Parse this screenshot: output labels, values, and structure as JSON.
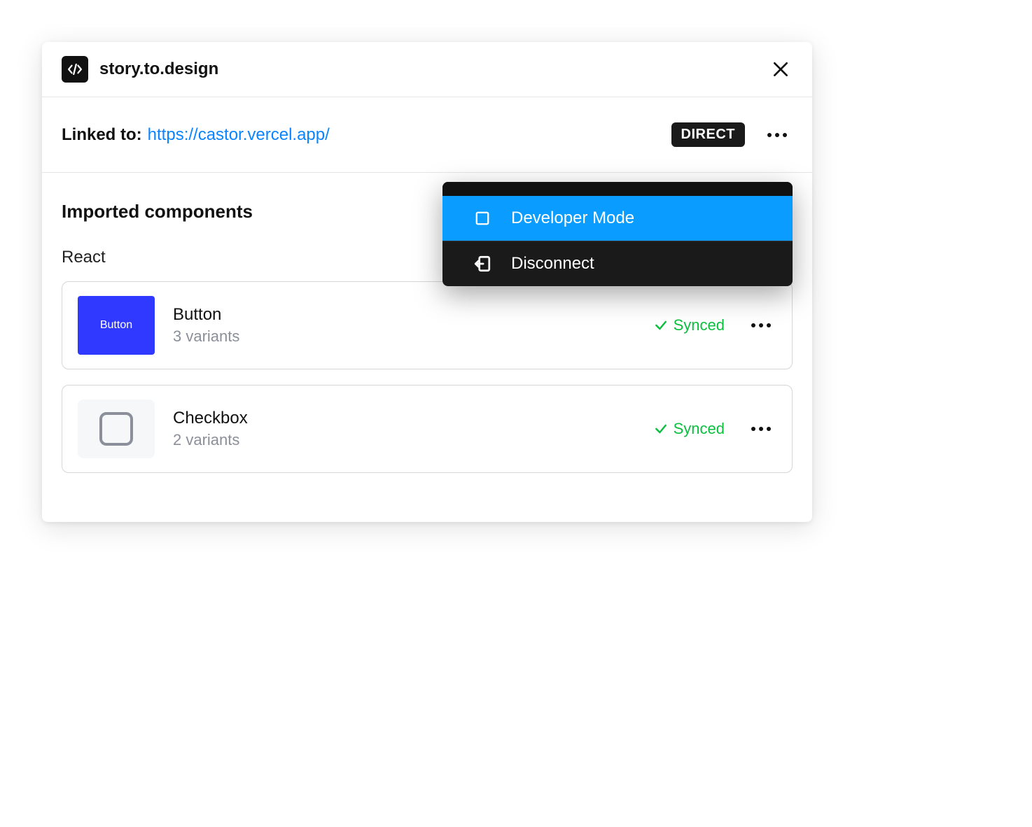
{
  "header": {
    "title": "story.to.design"
  },
  "linked": {
    "label": "Linked to:",
    "url": "https://castor.vercel.app/",
    "badge": "DIRECT"
  },
  "dropdown": {
    "items": [
      {
        "label": "Developer Mode",
        "active": true,
        "icon": "square-icon"
      },
      {
        "label": "Disconnect",
        "active": false,
        "icon": "disconnect-icon"
      }
    ]
  },
  "body": {
    "section_title": "Imported components",
    "framework": "React",
    "components": [
      {
        "name": "Button",
        "variants": "3 variants",
        "status": "Synced",
        "thumb": "button",
        "thumb_label": "Button"
      },
      {
        "name": "Checkbox",
        "variants": "2 variants",
        "status": "Synced",
        "thumb": "checkbox"
      }
    ]
  }
}
